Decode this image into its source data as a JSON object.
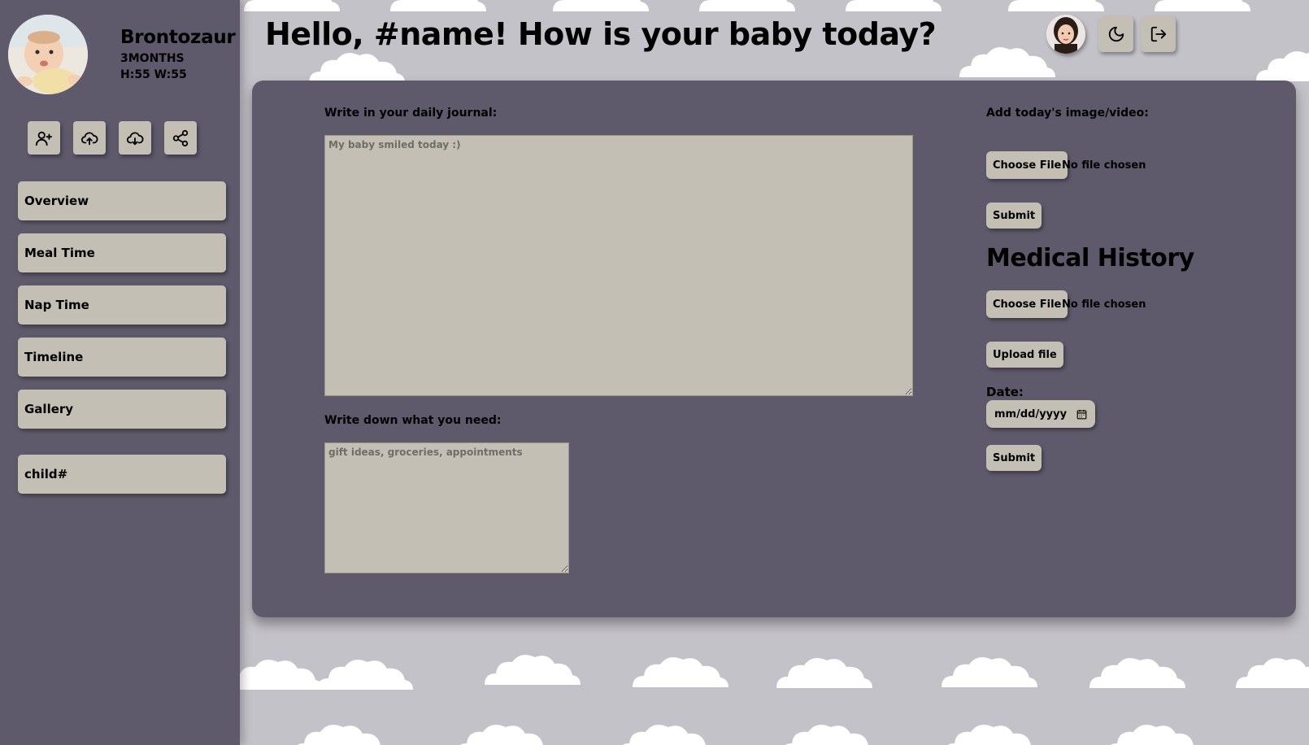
{
  "header": {
    "greeting": "Hello, #name! How is your baby today?"
  },
  "profile": {
    "name": "Brontozaur",
    "age": "3MONTHS",
    "stats": "H:55 W:55"
  },
  "sidebar_actions": [
    {
      "icon": "add-user-icon"
    },
    {
      "icon": "cloud-upload-icon"
    },
    {
      "icon": "cloud-download-icon"
    },
    {
      "icon": "share-icon"
    }
  ],
  "nav": {
    "overview": "Overview",
    "meal_time": "Meal Time",
    "nap_time": "Nap Time",
    "timeline": "Timeline",
    "gallery": "Gallery",
    "child": "child#"
  },
  "top_actions": [
    {
      "icon": "moon-icon"
    },
    {
      "icon": "logout-icon"
    }
  ],
  "journal": {
    "label": "Write in your daily journal:",
    "placeholder": "My baby smiled today :)"
  },
  "needs": {
    "label": "Write down what you need:",
    "placeholder": "gift ideas, groceries, appointments"
  },
  "media": {
    "label": "Add today's image/video:",
    "choose_file": "Choose File",
    "file_status": "No file chosen",
    "submit": "Submit"
  },
  "medical": {
    "heading": "Medical History",
    "choose_file": "Choose File",
    "file_status": "No file chosen",
    "upload": "Upload file",
    "date_label": "Date:",
    "date_placeholder": "mm/dd/yyyy",
    "submit": "Submit"
  },
  "colors": {
    "sidebar_bg": "#5e5a6c",
    "button_bg": "#c3bfb4",
    "page_bg": "#c3c2c8"
  }
}
